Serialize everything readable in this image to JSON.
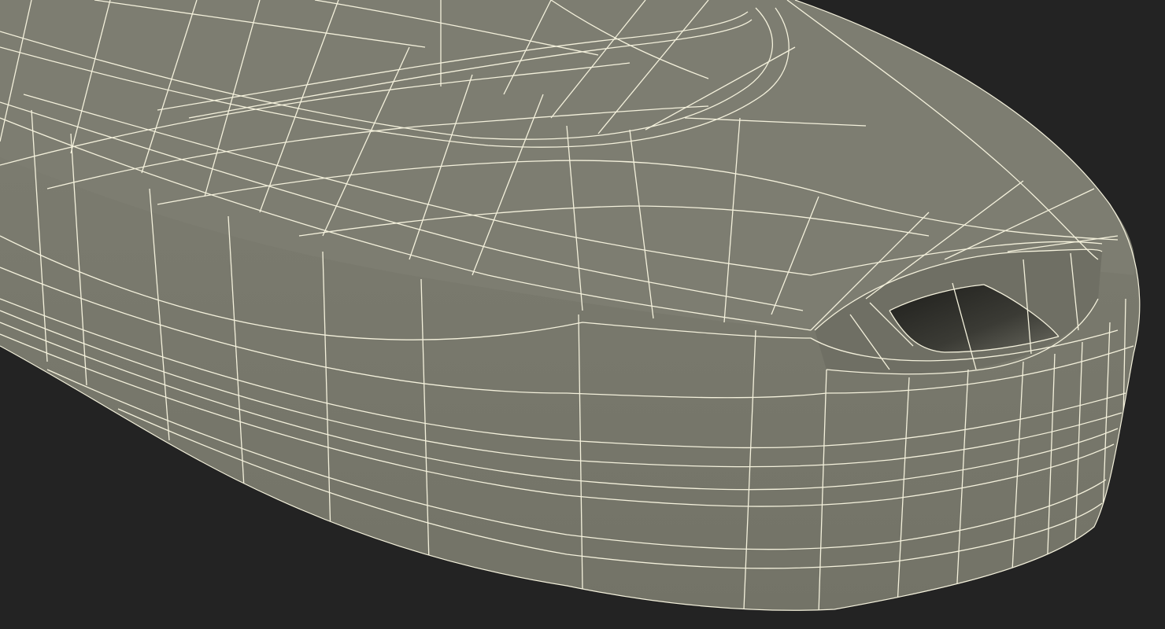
{
  "scene": {
    "subject": "wireframe-mesh-object",
    "colors": {
      "background": "#232323",
      "surface_top": "#7c7c70",
      "surface_side": "#76766a",
      "surface_shadow": "#5e5e54",
      "slot_dark": "#2a2a26",
      "wire": "#f4f1dc"
    }
  }
}
